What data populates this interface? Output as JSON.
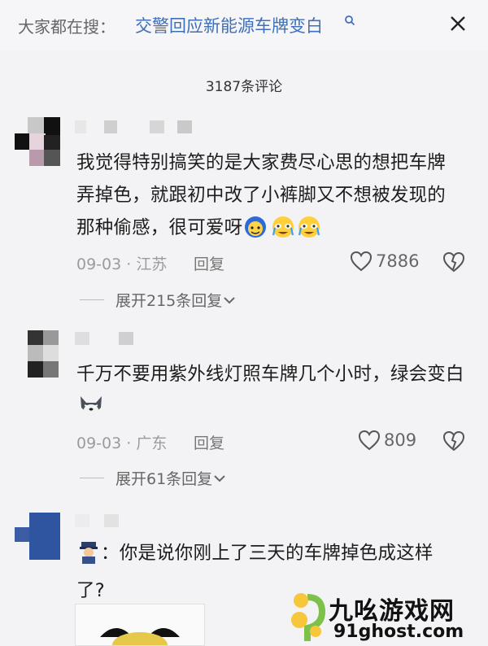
{
  "search": {
    "prefix": "大家都在搜：",
    "query": "交警回应新能源车牌变白"
  },
  "comment_count": "3187条评论",
  "comments": [
    {
      "text": "我觉得特别搞笑的是大家费尽心思的想把车牌弄掉色，就跟初中改了小裤脚又不想被发现的那种偷感，很可爱呀",
      "date": "09-03",
      "location": "江苏",
      "reply_label": "回复",
      "likes": "7886",
      "expand_label": "展开215条回复"
    },
    {
      "text": "千万不要用紫外线灯照车牌几个小时，绿会变白",
      "date": "09-03",
      "location": "广东",
      "reply_label": "回复",
      "likes": "809",
      "expand_label": "展开61条回复"
    },
    {
      "text": "你是说你刚上了三天的车牌掉色成这样了?"
    }
  ],
  "watermark": {
    "title": "九吆游戏网",
    "url": "91ghost.com"
  },
  "colors": {
    "link": "#3e6fb8",
    "background": "#f3f3f5",
    "muted_text": "#9b9b9b"
  }
}
